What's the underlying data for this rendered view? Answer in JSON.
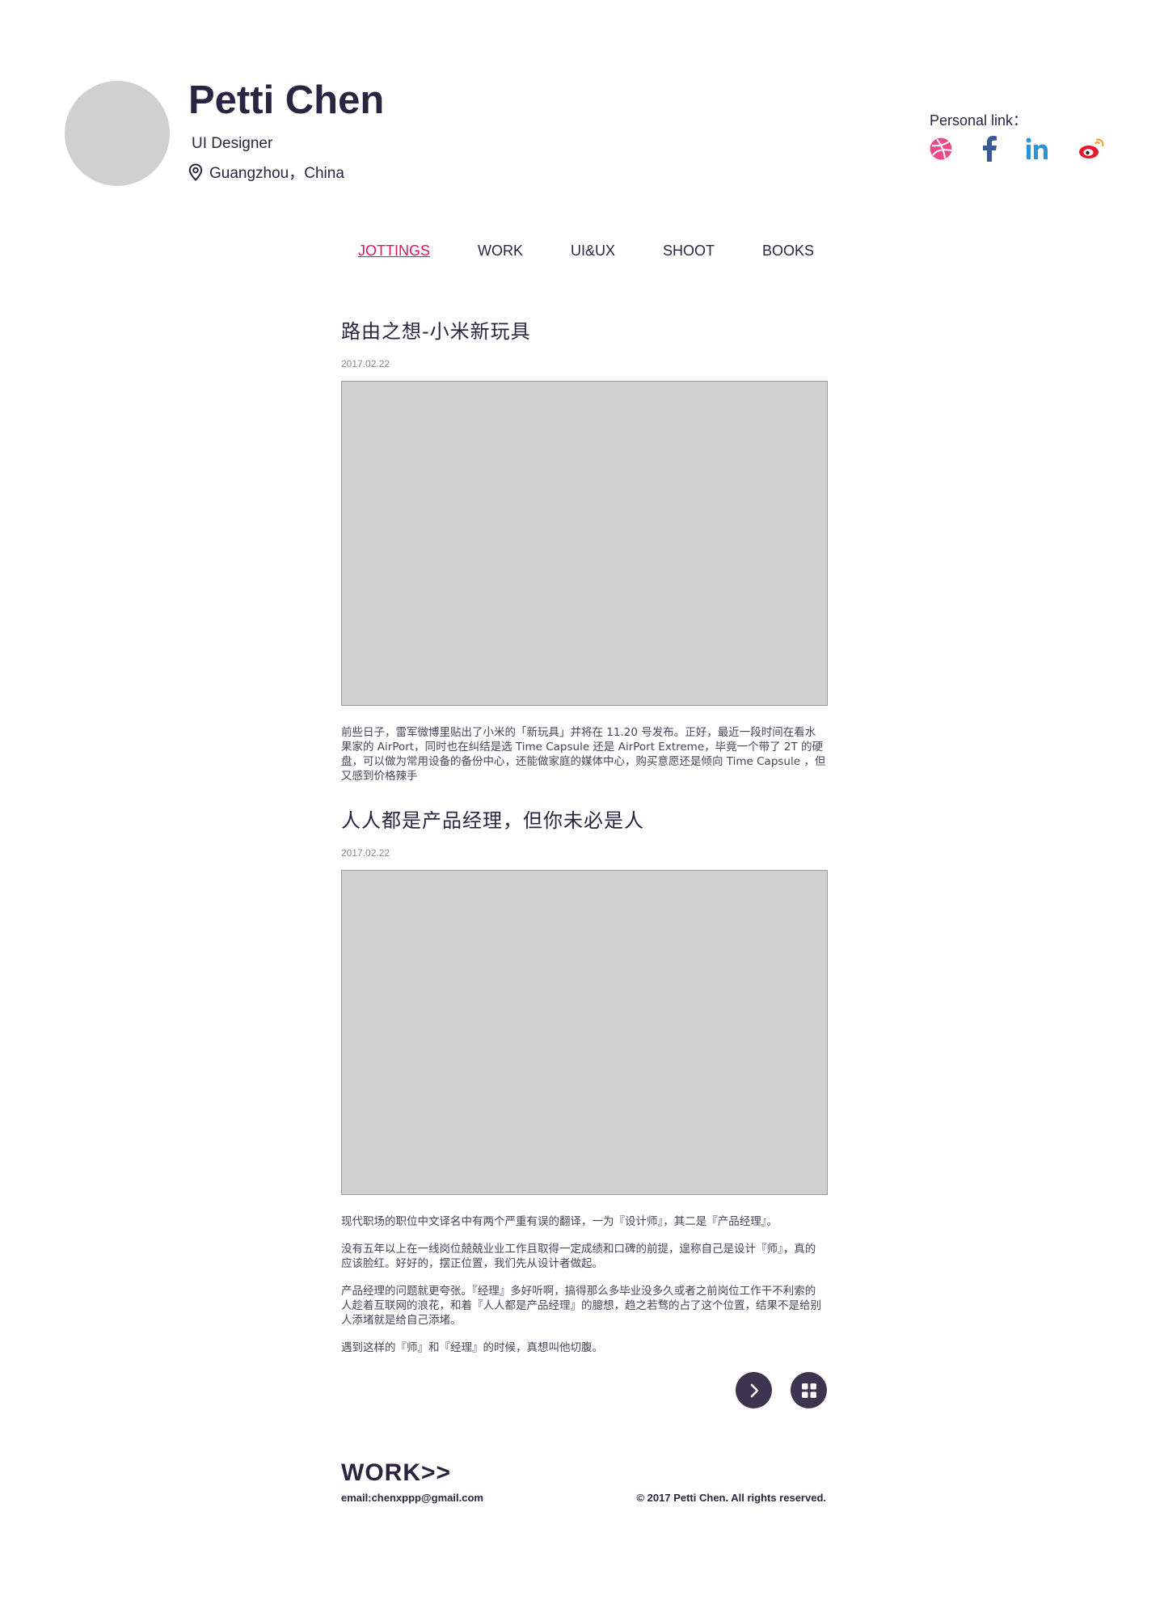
{
  "profile": {
    "name": "Petti Chen",
    "role": "UI Designer",
    "location": "Guangzhou，China"
  },
  "personal_links": {
    "label": "Personal link：",
    "items": [
      {
        "icon": "dribbble-icon",
        "color": "#ea4c89"
      },
      {
        "icon": "facebook-icon",
        "color": "#3b5998"
      },
      {
        "icon": "linkedin-icon",
        "color": "#2a94d6"
      },
      {
        "icon": "weibo-icon",
        "color": "#e6162d"
      }
    ]
  },
  "nav": {
    "items": [
      "JOTTINGS",
      "WORK",
      "UI&UX",
      "SHOOT",
      "BOOKS"
    ],
    "active": "JOTTINGS",
    "active_color": "#e5135b"
  },
  "posts": [
    {
      "title": "路由之想-小米新玩具",
      "date": "2017.02.22",
      "paragraphs": [
        "前些日子，雷军微博里贴出了小米的「新玩具」并将在 11.20 号发布。正好，最近一段时间在看水果家的 AirPort，同时也在纠结是选 Time Capsule 还是 AirPort Extreme，毕竟一个带了 2T 的硬盘，可以做为常用设备的备份中心，还能做家庭的媒体中心，购买意愿还是倾向 Time Capsule ，但又感到价格辣手"
      ]
    },
    {
      "title": "人人都是产品经理，但你未必是人",
      "date": "2017.02.22",
      "paragraphs": [
        "现代职场的职位中文译名中有两个严重有误的翻译，一为『设计师』，其二是『产品经理』。",
        "没有五年以上在一线岗位兢兢业业工作且取得一定成绩和口碑的前提，遑称自己是设计『师』，真的应该脸红。好好的，摆正位置，我们先从设计者做起。",
        "产品经理的问题就更夸张。『经理』多好听啊，搞得那么多毕业没多久或者之前岗位工作干不利索的人趁着互联网的浪花，和着『人人都是产品经理』的臆想，趋之若骛的占了这个位置，结果不是给别人添堵就是给自己添堵。",
        "遇到这样的『师』和『经理』的时候，真想叫他切腹。"
      ]
    }
  ],
  "pagination": {
    "next_icon": "chevron-right-icon",
    "grid_icon": "grid-icon"
  },
  "footer": {
    "work_link": "WORK>>",
    "email": "email:chenxppp@gmail.com",
    "copyright": "© 2017 Petti Chen. All rights reserved."
  }
}
